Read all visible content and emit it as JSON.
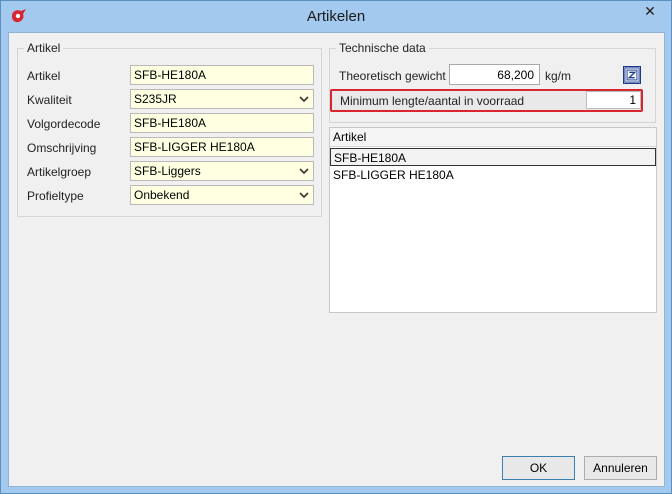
{
  "window": {
    "title": "Artikelen",
    "close_glyph": "✕"
  },
  "artikel_group": {
    "title": "Artikel",
    "fields": [
      {
        "label": "Artikel",
        "value": "SFB-HE180A",
        "dropdown": false
      },
      {
        "label": "Kwaliteit",
        "value": "S235JR",
        "dropdown": true
      },
      {
        "label": "Volgordecode",
        "value": "SFB-HE180A",
        "dropdown": false
      },
      {
        "label": "Omschrijving",
        "value": "SFB-LIGGER HE180A",
        "dropdown": false
      },
      {
        "label": "Artikelgroep",
        "value": "SFB-Liggers",
        "dropdown": true
      },
      {
        "label": "Profieltype",
        "value": "Onbekend",
        "dropdown": true
      }
    ]
  },
  "technische_group": {
    "title": "Technische data",
    "gewicht_label": "Theoretisch gewicht",
    "gewicht_value": "68,200",
    "gewicht_unit": "kg/m",
    "min_label": "Minimum lengte/aantal in voorraad",
    "min_value": "1"
  },
  "list": {
    "header": "Artikel",
    "rows": [
      "SFB-HE180A",
      "SFB-LIGGER HE180A"
    ]
  },
  "buttons": {
    "ok": "OK",
    "cancel": "Annuleren"
  },
  "colors": {
    "accent_red": "#d9262e",
    "field_bg": "#ffffe1",
    "title_bg": "#a3c9ee"
  }
}
